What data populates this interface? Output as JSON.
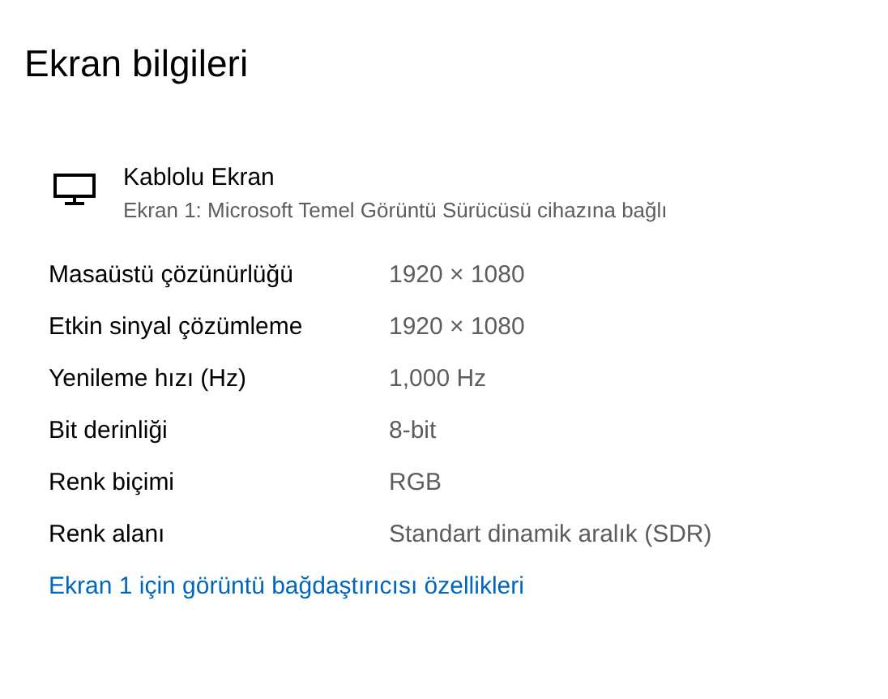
{
  "title": "Ekran bilgileri",
  "display": {
    "name": "Kablolu Ekran",
    "description": "Ekran 1: Microsoft Temel Görüntü Sürücüsü cihazına bağlı"
  },
  "properties": [
    {
      "label": "Masaüstü çözünürlüğü",
      "value": "1920 × 1080"
    },
    {
      "label": "Etkin sinyal çözümleme",
      "value": "1920 × 1080"
    },
    {
      "label": "Yenileme hızı (Hz)",
      "value": "1,000 Hz"
    },
    {
      "label": "Bit derinliği",
      "value": "8-bit"
    },
    {
      "label": "Renk biçimi",
      "value": "RGB"
    },
    {
      "label": "Renk alanı",
      "value": "Standart dinamik aralık (SDR)"
    }
  ],
  "link": "Ekran 1 için görüntü bağdaştırıcısı özellikleri"
}
